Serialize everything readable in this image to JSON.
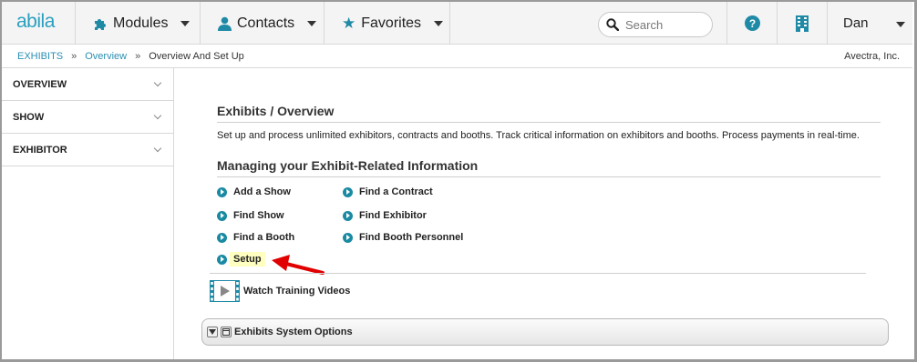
{
  "app": {
    "logo": "abila"
  },
  "nav": {
    "modules": "Modules",
    "contacts": "Contacts",
    "favorites": "Favorites",
    "search_placeholder": "Search",
    "user": "Dan"
  },
  "breadcrumb": {
    "items": [
      "EXHIBITS",
      "Overview"
    ],
    "separator": "»",
    "current": "Overview And Set Up",
    "organization": "Avectra, Inc."
  },
  "sidebar": {
    "items": [
      {
        "label": "OVERVIEW"
      },
      {
        "label": "SHOW"
      },
      {
        "label": "EXHIBITOR"
      }
    ]
  },
  "main": {
    "title": "Exhibits / Overview",
    "description": "Set up and process unlimited exhibitors, contracts and booths. Track critical information on exhibitors and booths. Process payments in real-time.",
    "section_title": "Managing your Exhibit-Related Information",
    "links_left": [
      "Add a Show",
      "Find Show",
      "Find a Booth",
      "Setup"
    ],
    "links_right": [
      "Find a Contract",
      "Find Exhibitor",
      "Find Booth Personnel"
    ],
    "training_link": "Watch Training Videos",
    "system_options": "Exhibits System Options"
  },
  "colors": {
    "accent": "#1f8aa6",
    "link": "#2a8fb3",
    "highlight": "#ffffc0",
    "arrow": "#e00000"
  }
}
